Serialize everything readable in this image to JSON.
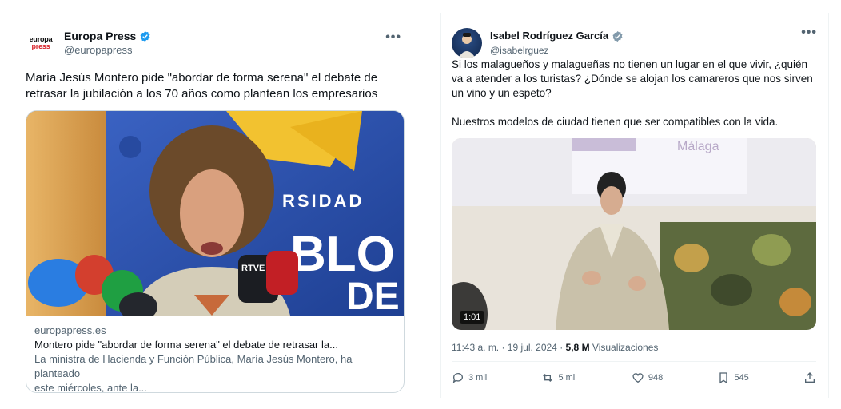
{
  "left_tweet": {
    "author_logo_top": "europa",
    "author_logo_bottom": "press",
    "author_name": "Europa Press",
    "author_handle": "@europapress",
    "text": "María Jesús Montero pide \"abordar de forma serena\" el debate de retrasar la jubilación a los 70 años como plantean los empresarios",
    "card": {
      "domain": "europapress.es",
      "title": "Montero pide \"abordar de forma serena\" el debate de retrasar la...",
      "description_line1": "La ministra de Hacienda y Función Pública, María Jesús Montero, ha planteado",
      "description_line2": "este miércoles, ante la...",
      "image_sign_text": "RSIDAD",
      "image_sign_text2": "BLO",
      "image_sign_text3": "DE",
      "image_mic_label": "RTVE"
    }
  },
  "right_tweet": {
    "author_name": "Isabel Rodríguez García",
    "author_handle": "@isabelrguez",
    "text": "Si los malagueños y malagueñas no tienen un lugar en el que vivir, ¿quién va a atender a los turistas? ¿Dónde se alojan los camareros que nos sirven un vino y un espeto?\n\nNuestros modelos de ciudad tienen que ser compatibles con la vida.",
    "video": {
      "duration": "1:01",
      "screen_text": "Málaga"
    },
    "time": "11:43 a. m. · 19 jul. 2024 ·",
    "views_count": "5,8 M",
    "views_label": "Visualizaciones",
    "actions": {
      "replies": "3 mil",
      "reposts": "5 mil",
      "likes": "948",
      "bookmarks": "545"
    }
  },
  "more_icon": "•••",
  "colors": {
    "verified": "#1d9bf0",
    "verified_gray": "#829aab",
    "brand_red": "#d8232a"
  }
}
